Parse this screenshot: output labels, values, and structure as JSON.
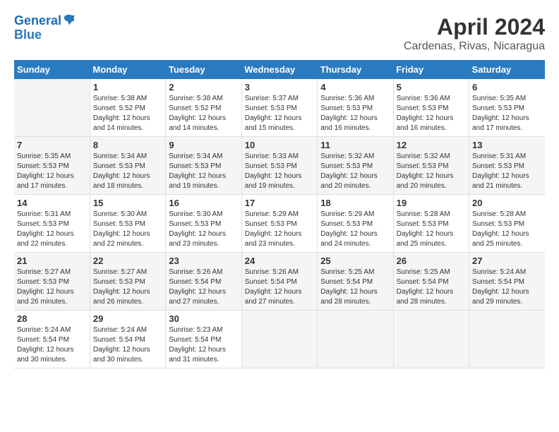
{
  "logo": {
    "line1": "General",
    "line2": "Blue"
  },
  "title": "April 2024",
  "subtitle": "Cardenas, Rivas, Nicaragua",
  "days_of_week": [
    "Sunday",
    "Monday",
    "Tuesday",
    "Wednesday",
    "Thursday",
    "Friday",
    "Saturday"
  ],
  "weeks": [
    [
      {
        "day": "",
        "sunrise": "",
        "sunset": "",
        "daylight": ""
      },
      {
        "day": "1",
        "sunrise": "Sunrise: 5:38 AM",
        "sunset": "Sunset: 5:52 PM",
        "daylight": "Daylight: 12 hours and 14 minutes."
      },
      {
        "day": "2",
        "sunrise": "Sunrise: 5:38 AM",
        "sunset": "Sunset: 5:52 PM",
        "daylight": "Daylight: 12 hours and 14 minutes."
      },
      {
        "day": "3",
        "sunrise": "Sunrise: 5:37 AM",
        "sunset": "Sunset: 5:53 PM",
        "daylight": "Daylight: 12 hours and 15 minutes."
      },
      {
        "day": "4",
        "sunrise": "Sunrise: 5:36 AM",
        "sunset": "Sunset: 5:53 PM",
        "daylight": "Daylight: 12 hours and 16 minutes."
      },
      {
        "day": "5",
        "sunrise": "Sunrise: 5:36 AM",
        "sunset": "Sunset: 5:53 PM",
        "daylight": "Daylight: 12 hours and 16 minutes."
      },
      {
        "day": "6",
        "sunrise": "Sunrise: 5:35 AM",
        "sunset": "Sunset: 5:53 PM",
        "daylight": "Daylight: 12 hours and 17 minutes."
      }
    ],
    [
      {
        "day": "7",
        "sunrise": "Sunrise: 5:35 AM",
        "sunset": "Sunset: 5:53 PM",
        "daylight": "Daylight: 12 hours and 17 minutes."
      },
      {
        "day": "8",
        "sunrise": "Sunrise: 5:34 AM",
        "sunset": "Sunset: 5:53 PM",
        "daylight": "Daylight: 12 hours and 18 minutes."
      },
      {
        "day": "9",
        "sunrise": "Sunrise: 5:34 AM",
        "sunset": "Sunset: 5:53 PM",
        "daylight": "Daylight: 12 hours and 19 minutes."
      },
      {
        "day": "10",
        "sunrise": "Sunrise: 5:33 AM",
        "sunset": "Sunset: 5:53 PM",
        "daylight": "Daylight: 12 hours and 19 minutes."
      },
      {
        "day": "11",
        "sunrise": "Sunrise: 5:32 AM",
        "sunset": "Sunset: 5:53 PM",
        "daylight": "Daylight: 12 hours and 20 minutes."
      },
      {
        "day": "12",
        "sunrise": "Sunrise: 5:32 AM",
        "sunset": "Sunset: 5:53 PM",
        "daylight": "Daylight: 12 hours and 20 minutes."
      },
      {
        "day": "13",
        "sunrise": "Sunrise: 5:31 AM",
        "sunset": "Sunset: 5:53 PM",
        "daylight": "Daylight: 12 hours and 21 minutes."
      }
    ],
    [
      {
        "day": "14",
        "sunrise": "Sunrise: 5:31 AM",
        "sunset": "Sunset: 5:53 PM",
        "daylight": "Daylight: 12 hours and 22 minutes."
      },
      {
        "day": "15",
        "sunrise": "Sunrise: 5:30 AM",
        "sunset": "Sunset: 5:53 PM",
        "daylight": "Daylight: 12 hours and 22 minutes."
      },
      {
        "day": "16",
        "sunrise": "Sunrise: 5:30 AM",
        "sunset": "Sunset: 5:53 PM",
        "daylight": "Daylight: 12 hours and 23 minutes."
      },
      {
        "day": "17",
        "sunrise": "Sunrise: 5:29 AM",
        "sunset": "Sunset: 5:53 PM",
        "daylight": "Daylight: 12 hours and 23 minutes."
      },
      {
        "day": "18",
        "sunrise": "Sunrise: 5:29 AM",
        "sunset": "Sunset: 5:53 PM",
        "daylight": "Daylight: 12 hours and 24 minutes."
      },
      {
        "day": "19",
        "sunrise": "Sunrise: 5:28 AM",
        "sunset": "Sunset: 5:53 PM",
        "daylight": "Daylight: 12 hours and 25 minutes."
      },
      {
        "day": "20",
        "sunrise": "Sunrise: 5:28 AM",
        "sunset": "Sunset: 5:53 PM",
        "daylight": "Daylight: 12 hours and 25 minutes."
      }
    ],
    [
      {
        "day": "21",
        "sunrise": "Sunrise: 5:27 AM",
        "sunset": "Sunset: 5:53 PM",
        "daylight": "Daylight: 12 hours and 26 minutes."
      },
      {
        "day": "22",
        "sunrise": "Sunrise: 5:27 AM",
        "sunset": "Sunset: 5:53 PM",
        "daylight": "Daylight: 12 hours and 26 minutes."
      },
      {
        "day": "23",
        "sunrise": "Sunrise: 5:26 AM",
        "sunset": "Sunset: 5:54 PM",
        "daylight": "Daylight: 12 hours and 27 minutes."
      },
      {
        "day": "24",
        "sunrise": "Sunrise: 5:26 AM",
        "sunset": "Sunset: 5:54 PM",
        "daylight": "Daylight: 12 hours and 27 minutes."
      },
      {
        "day": "25",
        "sunrise": "Sunrise: 5:25 AM",
        "sunset": "Sunset: 5:54 PM",
        "daylight": "Daylight: 12 hours and 28 minutes."
      },
      {
        "day": "26",
        "sunrise": "Sunrise: 5:25 AM",
        "sunset": "Sunset: 5:54 PM",
        "daylight": "Daylight: 12 hours and 28 minutes."
      },
      {
        "day": "27",
        "sunrise": "Sunrise: 5:24 AM",
        "sunset": "Sunset: 5:54 PM",
        "daylight": "Daylight: 12 hours and 29 minutes."
      }
    ],
    [
      {
        "day": "28",
        "sunrise": "Sunrise: 5:24 AM",
        "sunset": "Sunset: 5:54 PM",
        "daylight": "Daylight: 12 hours and 30 minutes."
      },
      {
        "day": "29",
        "sunrise": "Sunrise: 5:24 AM",
        "sunset": "Sunset: 5:54 PM",
        "daylight": "Daylight: 12 hours and 30 minutes."
      },
      {
        "day": "30",
        "sunrise": "Sunrise: 5:23 AM",
        "sunset": "Sunset: 5:54 PM",
        "daylight": "Daylight: 12 hours and 31 minutes."
      },
      {
        "day": "",
        "sunrise": "",
        "sunset": "",
        "daylight": ""
      },
      {
        "day": "",
        "sunrise": "",
        "sunset": "",
        "daylight": ""
      },
      {
        "day": "",
        "sunrise": "",
        "sunset": "",
        "daylight": ""
      },
      {
        "day": "",
        "sunrise": "",
        "sunset": "",
        "daylight": ""
      }
    ]
  ]
}
